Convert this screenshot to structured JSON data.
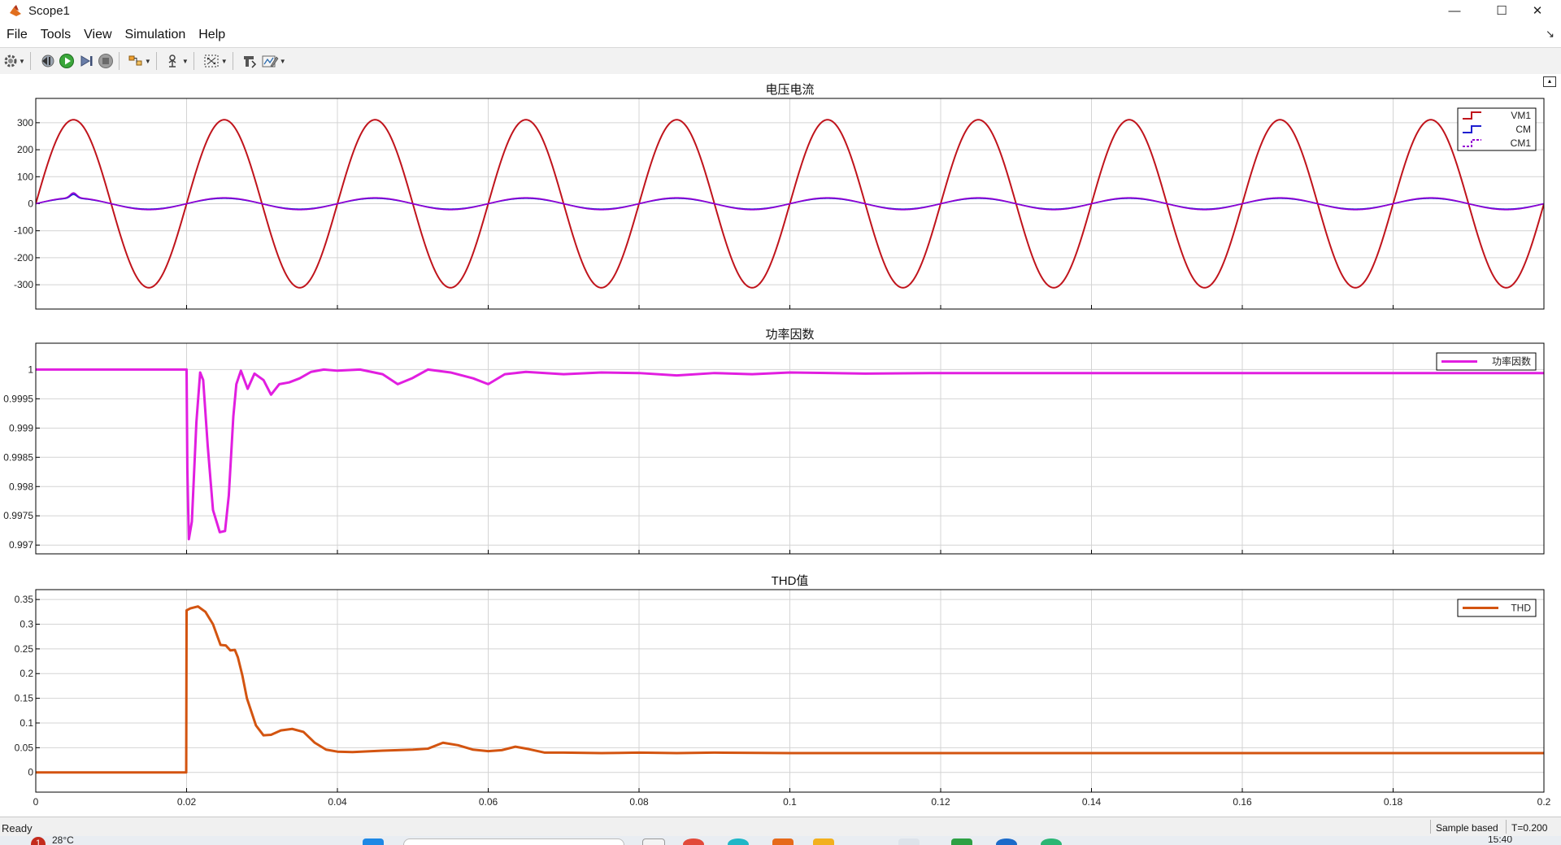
{
  "window": {
    "title": "Scope1",
    "minimize_glyph": "—",
    "maximize_glyph": "☐",
    "close_glyph": "✕"
  },
  "menu": {
    "items": [
      "File",
      "Tools",
      "View",
      "Simulation",
      "Help"
    ],
    "unpin_glyph": "↘"
  },
  "toolbar": {
    "icons": [
      "settings-icon",
      "step-back-icon",
      "run-icon",
      "step-forward-icon",
      "stop-icon",
      "signal-selector-icon",
      "triggers-icon",
      "zoom-icon",
      "restore-layout-icon",
      "style-icon"
    ]
  },
  "colors": {
    "vm1": "#c0141c",
    "cm": "#1f1fd0",
    "cm1": "#9400d3",
    "power_factor": "#e11ee0",
    "thd": "#d35410",
    "grid": "#d4d4d4",
    "axes": "#000000"
  },
  "chart_data": [
    {
      "type": "line",
      "title": "电压电流",
      "xlim": [
        0,
        0.2
      ],
      "ylim": [
        -390,
        390
      ],
      "yticks": [
        "300",
        "200",
        "100",
        "0",
        "-100",
        "-200",
        "-300"
      ],
      "ytick_values": [
        300,
        200,
        100,
        0,
        -100,
        -200,
        -300
      ],
      "legend": "top-right",
      "grid": true,
      "series": [
        {
          "name": "VM1",
          "color": "#c0141c",
          "description_values": {
            "waveform": "sine",
            "amplitude": 311,
            "frequency_hz": 50,
            "phase": 0
          }
        },
        {
          "name": "CM",
          "color": "#1f1fd0",
          "description_values": {
            "waveform": "sine",
            "amplitude": 20,
            "frequency_hz": 50,
            "phase": 0
          }
        },
        {
          "name": "CM1",
          "color": "#9400d3",
          "description_values": {
            "waveform": "sine",
            "amplitude": 22,
            "frequency_hz": 50,
            "phase": 0
          }
        }
      ]
    },
    {
      "type": "line",
      "title": "功率因数",
      "xlim": [
        0,
        0.2
      ],
      "ylim": [
        0.99685,
        1.00045
      ],
      "yticks": [
        "1",
        "0.9995",
        "0.999",
        "0.9985",
        "0.998",
        "0.9975",
        "0.997"
      ],
      "ytick_values": [
        1,
        0.9995,
        0.999,
        0.9985,
        0.998,
        0.9975,
        0.997
      ],
      "legend": "top-right",
      "grid": true,
      "series": [
        {
          "name": "功率因数",
          "color": "#e11ee0",
          "x": [
            0,
            0.02,
            0.0201,
            0.0203,
            0.0207,
            0.0213,
            0.0218,
            0.0222,
            0.0228,
            0.0235,
            0.0244,
            0.0251,
            0.0256,
            0.0262,
            0.0266,
            0.0272,
            0.0281,
            0.029,
            0.0302,
            0.0312,
            0.0323,
            0.0336,
            0.035,
            0.0365,
            0.0382,
            0.04,
            0.043,
            0.046,
            0.048,
            0.0499,
            0.052,
            0.055,
            0.058,
            0.06,
            0.0622,
            0.065,
            0.07,
            0.075,
            0.08,
            0.085,
            0.09,
            0.095,
            0.1,
            0.11,
            0.12,
            0.2
          ],
          "values": [
            1.0,
            1.0,
            0.9983,
            0.9971,
            0.9974,
            0.9991,
            0.99995,
            0.99982,
            0.9987,
            0.9976,
            0.99722,
            0.99724,
            0.99785,
            0.9992,
            0.99975,
            0.99998,
            0.99967,
            0.99993,
            0.99982,
            0.99957,
            0.99975,
            0.99978,
            0.99985,
            0.99996,
            1.0,
            0.99998,
            1.0,
            0.99992,
            0.99975,
            0.99985,
            1.0,
            0.99995,
            0.99985,
            0.99975,
            0.99992,
            0.99996,
            0.99992,
            0.99995,
            0.99994,
            0.9999,
            0.99994,
            0.99992,
            0.99995,
            0.99993,
            0.99994,
            0.99994
          ]
        }
      ]
    },
    {
      "type": "line",
      "title": "THD值",
      "xlabel": "",
      "xlim": [
        0,
        0.2
      ],
      "ylim": [
        -0.04,
        0.37
      ],
      "yticks": [
        "0.35",
        "0.3",
        "0.25",
        "0.2",
        "0.15",
        "0.1",
        "0.05",
        "0"
      ],
      "ytick_values": [
        0.35,
        0.3,
        0.25,
        0.2,
        0.15,
        0.1,
        0.05,
        0
      ],
      "xticks": [
        "0",
        "0.02",
        "0.04",
        "0.06",
        "0.08",
        "0.1",
        "0.12",
        "0.14",
        "0.16",
        "0.18",
        "0.2"
      ],
      "xtick_values": [
        0,
        0.02,
        0.04,
        0.06,
        0.08,
        0.1,
        0.12,
        0.14,
        0.16,
        0.18,
        0.2
      ],
      "legend": "top-right",
      "grid": true,
      "series": [
        {
          "name": "THD",
          "color": "#d35410",
          "x": [
            0,
            0.01995,
            0.02,
            0.0205,
            0.0215,
            0.0225,
            0.0235,
            0.0245,
            0.0252,
            0.0258,
            0.0264,
            0.0268,
            0.0274,
            0.028,
            0.0292,
            0.0302,
            0.0312,
            0.0325,
            0.034,
            0.0355,
            0.037,
            0.0385,
            0.04,
            0.042,
            0.046,
            0.05,
            0.052,
            0.054,
            0.056,
            0.058,
            0.06,
            0.0618,
            0.0636,
            0.0654,
            0.0675,
            0.07,
            0.075,
            0.08,
            0.085,
            0.09,
            0.1,
            0.12,
            0.2
          ],
          "values": [
            0,
            0,
            0.328,
            0.332,
            0.336,
            0.325,
            0.3,
            0.258,
            0.257,
            0.247,
            0.248,
            0.233,
            0.196,
            0.15,
            0.095,
            0.075,
            0.076,
            0.085,
            0.088,
            0.082,
            0.06,
            0.046,
            0.042,
            0.041,
            0.044,
            0.046,
            0.048,
            0.06,
            0.055,
            0.046,
            0.043,
            0.045,
            0.052,
            0.047,
            0.04,
            0.04,
            0.039,
            0.04,
            0.039,
            0.04,
            0.039,
            0.039,
            0.039
          ]
        }
      ]
    }
  ],
  "status": {
    "ready": "Ready",
    "sample_mode": "Sample based",
    "time": "T=0.200"
  },
  "taskbar": {
    "weather_badge": "1",
    "weather_temp": "28°C",
    "clock": "15:40"
  }
}
